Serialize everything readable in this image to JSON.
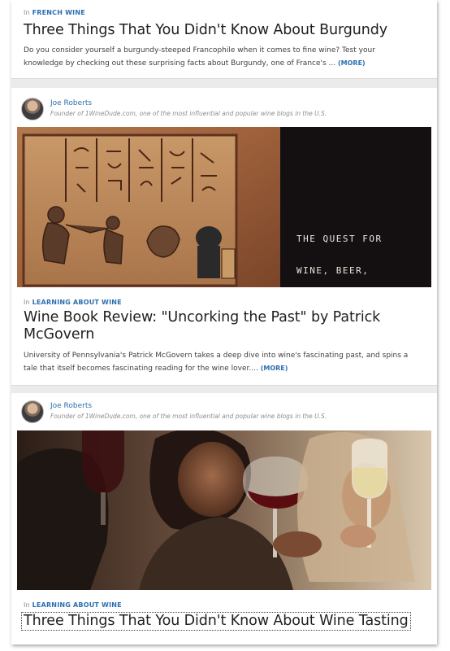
{
  "colors": {
    "link": "#2c6fb0",
    "title": "#1f1f1f",
    "meta": "#8a8a8a"
  },
  "posts": [
    {
      "category_prefix": "In",
      "category": "FRENCH WINE",
      "title": "Three Things That You Didn't Know About Burgundy",
      "excerpt_line1": "Do you consider yourself a burgundy-steeped Francophile when it comes to fine wine? Test your",
      "excerpt_line2": "knowledge by checking out these surprising facts about Burgundy, one of France's ...",
      "more": "(MORE)"
    },
    {
      "author": "Joe Roberts",
      "author_bio": "Founder of 1WineDude.com, one of the most influential and popular wine blogs in the U.S.",
      "image_text_line1": "THE QUEST FOR",
      "image_text_line2": "WINE, BEER,",
      "category_prefix": "In",
      "category": "LEARNING ABOUT WINE",
      "title_line1": "Wine Book Review: \"Uncorking the Past\" by Patrick",
      "title_line2": "McGovern",
      "excerpt_line1": "University of Pennsylvania's Patrick McGovern takes a deep dive into wine's fascinating past, and spins a",
      "excerpt_line2": "tale that itself becomes fascinating reading for the wine lover....",
      "more": "(MORE)"
    },
    {
      "author": "Joe Roberts",
      "author_bio": "Founder of 1WineDude.com, one of the most influential and popular wine blogs in the U.S.",
      "category_prefix": "In",
      "category": "LEARNING ABOUT WINE",
      "title": "Three Things That You Didn't Know About Wine Tasting"
    }
  ]
}
